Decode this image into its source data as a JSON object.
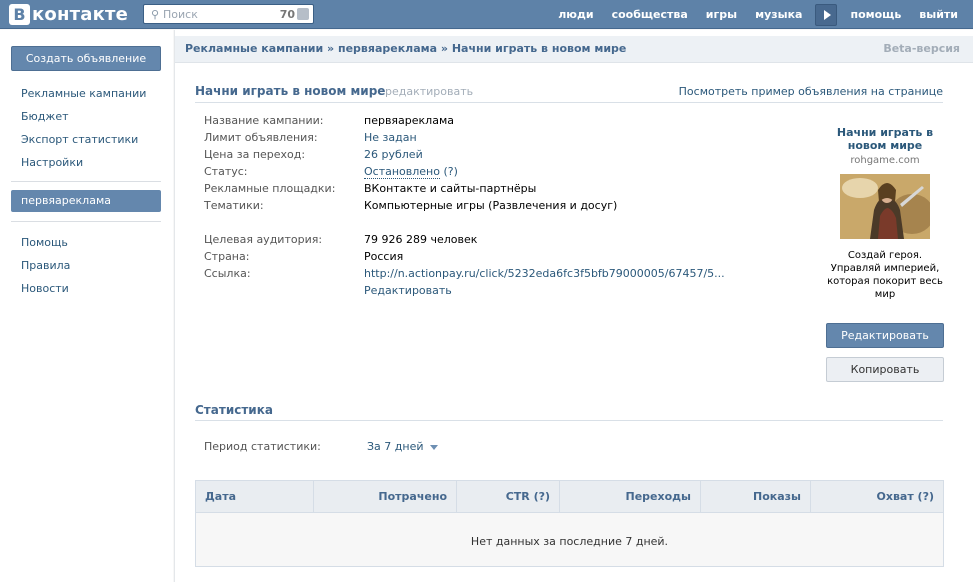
{
  "header": {
    "logo_letter": "В",
    "logo_text": "контакте",
    "search_placeholder": "Поиск",
    "search_count": "70",
    "nav": [
      "люди",
      "сообщества",
      "игры",
      "музыка"
    ],
    "nav_right": [
      "помощь",
      "выйти"
    ]
  },
  "sidebar": {
    "create_ad": "Создать объявление",
    "links_top": [
      "Рекламные кампании",
      "Бюджет",
      "Экспорт статистики",
      "Настройки"
    ],
    "active_campaign": "первяареклама",
    "links_bottom": [
      "Помощь",
      "Правила",
      "Новости"
    ]
  },
  "breadcrumb": {
    "text": "Рекламные кампании » первяареклама » Начни играть в новом мире",
    "beta": "Beta-версия"
  },
  "ad": {
    "title": "Начни играть в новом мире",
    "edit_link": "редактировать",
    "preview_link": "Посмотреть пример объявления на странице",
    "fields": [
      {
        "label": "Название кампании:",
        "value": "первяареклама"
      },
      {
        "label": "Лимит объявления:",
        "value": "Не задан"
      },
      {
        "label": "Цена за переход:",
        "value": "26 рублей"
      },
      {
        "label": "Статус:",
        "value": "Остановлено",
        "hint": "(?)"
      },
      {
        "label": "Рекламные площадки:",
        "value": "ВКонтакте и сайты-партнёры"
      },
      {
        "label": "Тематики:",
        "value": "Компьютерные игры (Развлечения и досуг)"
      },
      {
        "label": "Целевая аудитория:",
        "value": "79 926 289 человек"
      },
      {
        "label": "Страна:",
        "value": "Россия"
      },
      {
        "label": "Ссылка:",
        "value": "http://n.actionpay.ru/click/5232eda6fc3f5bfb79000005/67457/5..."
      }
    ],
    "link_edit": "Редактировать"
  },
  "preview": {
    "title": "Начни играть в новом мире",
    "domain": "rohgame.com",
    "description": "Создай героя. Управляй империей, которая покорит весь мир"
  },
  "buttons": {
    "edit": "Редактировать",
    "copy": "Копировать"
  },
  "stats": {
    "title": "Статистика",
    "period_label": "Период статистики:",
    "period_value": "За 7 дней",
    "columns": [
      "Дата",
      "Потрачено",
      "CTR (?)",
      "Переходы",
      "Показы",
      "Охват (?)"
    ],
    "empty_message": "Нет данных за последние 7 дней."
  },
  "colors": {
    "header_bg": "#5e82a8",
    "button_blue": "#6487ad",
    "link": "#2b587a",
    "title": "#45688e"
  }
}
